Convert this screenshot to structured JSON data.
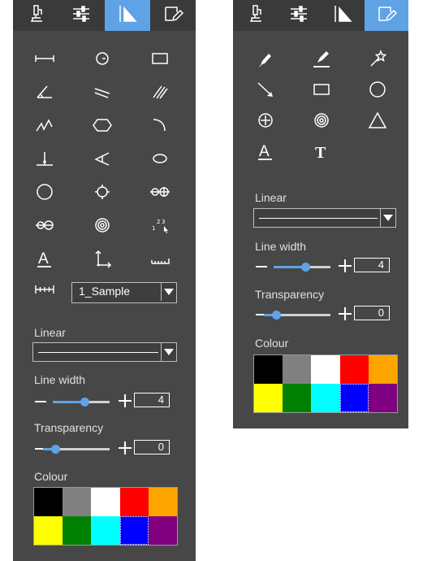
{
  "left_panel": {
    "tabs": [
      {
        "name": "microscope-icon",
        "active": false
      },
      {
        "name": "adjust-sliders-icon",
        "active": false
      },
      {
        "name": "measure-ruler-icon",
        "active": true
      },
      {
        "name": "annotate-edit-icon",
        "active": false
      }
    ],
    "tools": [
      "line-length-icon",
      "circle-center-icon",
      "rectangle-icon",
      "angle-icon",
      "parallel-lines-icon",
      "multi-parallel-icon",
      "polyline-icon",
      "hexagon-icon",
      "arc-icon",
      "perpendicular-icon",
      "angle-lines-icon",
      "ellipse-icon",
      "circle-icon",
      "circle-crosshair-icon",
      "two-circles-icon",
      "circle-distance-icon",
      "concentric-circles-icon",
      "point-count-icon",
      "text-a-icon",
      "coordinate-axes-icon",
      "scale-ruler-icon"
    ],
    "scale_bar_icon": "scale-bar-icon",
    "sample_select": {
      "value": "1_Sample"
    },
    "line_style": {
      "label": "Linear"
    },
    "line_width": {
      "label": "Line width",
      "value": "4",
      "level": 0.55
    },
    "transparency": {
      "label": "Transparency",
      "value": "0",
      "level": 0.18
    },
    "colour": {
      "label": "Colour",
      "selected_index": 8
    }
  },
  "right_panel": {
    "tabs": [
      {
        "name": "microscope-icon",
        "active": false
      },
      {
        "name": "adjust-sliders-icon",
        "active": false
      },
      {
        "name": "measure-ruler-icon",
        "active": false
      },
      {
        "name": "annotate-edit-icon",
        "active": true
      }
    ],
    "tools": [
      "pencil-icon",
      "highlighter-icon",
      "magic-wand-icon",
      "arrow-icon",
      "rectangle-icon",
      "circle-icon",
      "crosshair-circle-icon",
      "concentric-circles-icon",
      "triangle-icon",
      "text-a-icon",
      "text-t-icon"
    ],
    "line_style": {
      "label": "Linear"
    },
    "line_width": {
      "label": "Line width",
      "value": "4",
      "level": 0.55
    },
    "transparency": {
      "label": "Transparency",
      "value": "0",
      "level": 0.18
    },
    "colour": {
      "label": "Colour",
      "selected_index": 8
    }
  },
  "palette_colors": [
    "#000000",
    "#808080",
    "#ffffff",
    "#ff0000",
    "#ffa500",
    "#ffff00",
    "#008000",
    "#00ffff",
    "#0000ff",
    "#800080"
  ]
}
